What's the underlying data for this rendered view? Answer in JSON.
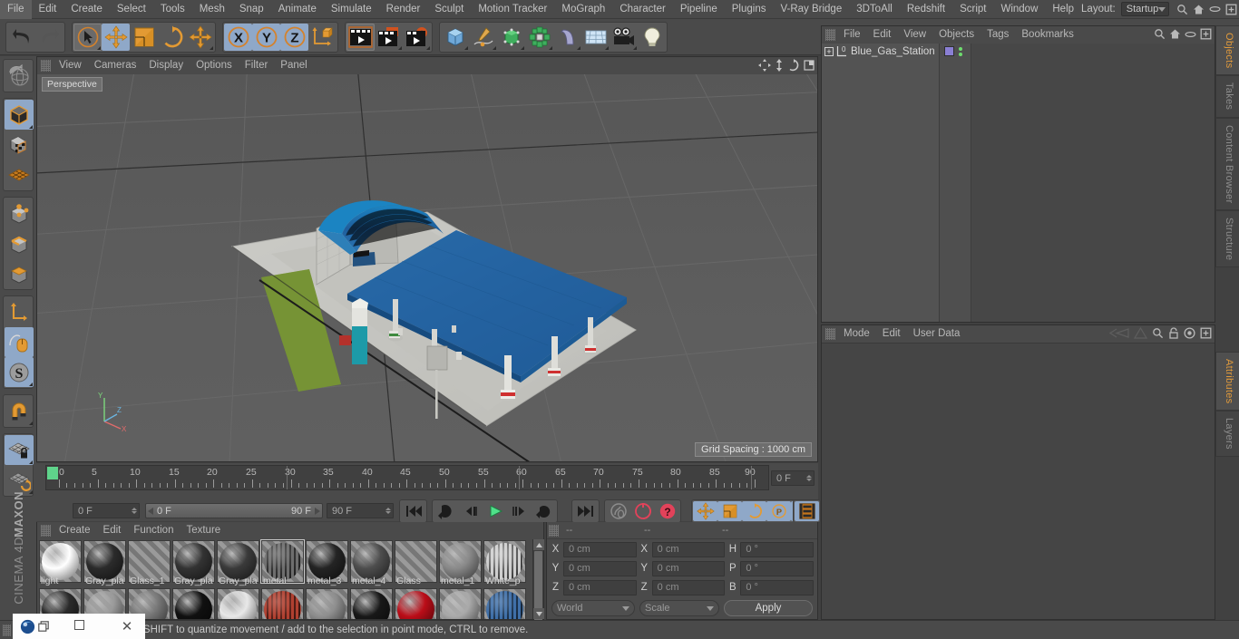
{
  "menubar": {
    "items": [
      "File",
      "Edit",
      "Create",
      "Select",
      "Tools",
      "Mesh",
      "Snap",
      "Animate",
      "Simulate",
      "Render",
      "Sculpt",
      "Motion Tracker",
      "MoGraph",
      "Character",
      "Pipeline",
      "Plugins",
      "V-Ray Bridge",
      "3DToAll",
      "Redshift",
      "Script",
      "Window",
      "Help"
    ],
    "layout_label": "Layout:",
    "layout_value": "Startup",
    "icons": [
      "search-icon",
      "home-icon",
      "pill-icon",
      "new-window-icon"
    ]
  },
  "toolbar": {
    "groups": [
      {
        "name": "undo-redo",
        "buttons": [
          {
            "icon": "undo-icon",
            "label": "Undo",
            "state": "normal"
          },
          {
            "icon": "redo-icon",
            "label": "Redo",
            "state": "disabled"
          }
        ]
      },
      {
        "name": "transform-tools",
        "buttons": [
          {
            "icon": "live-selection-icon",
            "label": "Live Selection",
            "state": "active"
          },
          {
            "icon": "move-icon",
            "label": "Move",
            "state": "selected"
          },
          {
            "icon": "scale-icon",
            "label": "Scale",
            "state": "normal"
          },
          {
            "icon": "rotate-icon",
            "label": "Rotate",
            "state": "normal"
          },
          {
            "icon": "move-alt-icon",
            "label": "Move",
            "state": "normal"
          }
        ]
      },
      {
        "name": "axis-locks",
        "buttons": [
          {
            "icon": "x-axis-icon",
            "label": "X Axis",
            "state": "selected"
          },
          {
            "icon": "y-axis-icon",
            "label": "Y Axis",
            "state": "selected"
          },
          {
            "icon": "z-axis-icon",
            "label": "Z Axis",
            "state": "selected"
          },
          {
            "icon": "world-object-axis-icon",
            "label": "World / Object Coordinate System",
            "state": "normal"
          }
        ]
      },
      {
        "name": "render-tools",
        "buttons": [
          {
            "icon": "render-view-icon",
            "label": "Render View",
            "state": "active"
          },
          {
            "icon": "render-region-icon",
            "label": "Render Region",
            "state": "normal"
          },
          {
            "icon": "render-settings-icon",
            "label": "Edit Render Settings",
            "state": "normal"
          }
        ]
      },
      {
        "name": "create-objects",
        "buttons": [
          {
            "icon": "cube-primitive-icon",
            "label": "Add Cube Object",
            "state": "normal"
          },
          {
            "icon": "spline-pen-icon",
            "label": "Spline Pen",
            "state": "normal"
          },
          {
            "icon": "generator-icon",
            "label": "Subdivision Surface",
            "state": "normal"
          },
          {
            "icon": "mograph-cloner-icon",
            "label": "MoGraph Cloner",
            "state": "normal"
          },
          {
            "icon": "deformer-bend-icon",
            "label": "Bend Deformer",
            "state": "normal"
          },
          {
            "icon": "environment-floor-icon",
            "label": "Floor / Environment",
            "state": "normal"
          },
          {
            "icon": "camera-icon",
            "label": "Camera",
            "state": "normal"
          },
          {
            "icon": "light-icon",
            "label": "Light",
            "state": "normal"
          }
        ]
      }
    ]
  },
  "leftbar": {
    "groups": [
      {
        "buttons": [
          {
            "icon": "undo-view-globe-icon",
            "label": "Undo View",
            "state": "normal"
          }
        ]
      },
      {
        "buttons": [
          {
            "icon": "model-mode-icon",
            "label": "Model Mode",
            "state": "selected"
          },
          {
            "icon": "texture-mode-icon",
            "label": "Texture Mode",
            "state": "normal"
          },
          {
            "icon": "deformer-grid-icon",
            "label": "Deformed Editing",
            "state": "normal"
          }
        ]
      },
      {
        "buttons": [
          {
            "icon": "points-mode-icon",
            "label": "Points Mode",
            "state": "normal"
          },
          {
            "icon": "edges-mode-icon",
            "label": "Edges Mode",
            "state": "normal"
          },
          {
            "icon": "polygons-mode-icon",
            "label": "Polygons Mode",
            "state": "normal"
          }
        ]
      },
      {
        "buttons": [
          {
            "icon": "axis-move-icon",
            "label": "Enable Axis Modification",
            "state": "normal"
          },
          {
            "icon": "viewport-solo-mouse-icon",
            "label": "Viewport Solo Single",
            "state": "selected"
          },
          {
            "icon": "workplane-icon",
            "label": "Workplane",
            "state": "selected"
          }
        ]
      },
      {
        "buttons": [
          {
            "icon": "magnet-icon",
            "label": "Enable Snapping",
            "state": "normal"
          }
        ]
      },
      {
        "buttons": [
          {
            "icon": "lock-workplane-icon",
            "label": "Lock Workplane",
            "state": "selected"
          },
          {
            "icon": "planar-workplane-icon",
            "label": "Planar Workplane",
            "state": "normal"
          }
        ]
      }
    ],
    "brand_line1": "MAXON",
    "brand_line2": "CINEMA 4D"
  },
  "viewport": {
    "menu_items": [
      "View",
      "Cameras",
      "Display",
      "Options",
      "Filter",
      "Panel"
    ],
    "right_icons": [
      "pan-icon",
      "move-camera-icon",
      "rotate-camera-icon",
      "maximize-view-icon"
    ],
    "view_label": "Perspective",
    "grid_spacing": "Grid Spacing : 1000 cm",
    "axis_labels": {
      "x": "X",
      "y": "Y",
      "z": "Z"
    },
    "scene_name": "Blue_Gas_Station"
  },
  "timeline": {
    "ruler_labels": [
      "0",
      "5",
      "10",
      "15",
      "20",
      "25",
      "30",
      "35",
      "40",
      "45",
      "50",
      "55",
      "60",
      "65",
      "70",
      "75",
      "80",
      "85",
      "90"
    ],
    "current_frame_right": "0 F",
    "current_frame_left": "0 F",
    "range_start": "0 F",
    "range_end": "90 F",
    "preview_end": "90 F",
    "transport": [
      {
        "icon": "go-to-start-icon",
        "label": "Go To Start Frame",
        "state": "normal"
      },
      {
        "icon": "play-reverse-icon",
        "label": "Play Backwards",
        "state": "normal"
      },
      {
        "icon": "previous-frame-icon",
        "label": "Go To Previous Frame",
        "state": "normal"
      },
      {
        "icon": "play-forward-icon",
        "label": "Play Forwards",
        "state": "normal"
      },
      {
        "icon": "next-frame-icon",
        "label": "Go To Next Frame",
        "state": "normal"
      },
      {
        "icon": "loop-icon",
        "label": "Loop Preview Range",
        "state": "normal"
      },
      {
        "icon": "go-to-end-icon",
        "label": "Go To End Frame",
        "state": "normal"
      }
    ],
    "keyframe_tools": [
      {
        "icon": "record-key-icon",
        "label": "Record Active Objects",
        "state": "disabled"
      },
      {
        "icon": "autokey-icon",
        "label": "Autokeying",
        "state": "normal"
      },
      {
        "icon": "keyframe-selection-icon",
        "label": "Keyframe Selection",
        "state": "normal"
      }
    ],
    "key_filters": [
      {
        "icon": "position-key-icon",
        "label": "Record Position",
        "state": "selected"
      },
      {
        "icon": "scale-key-icon",
        "label": "Record Scale",
        "state": "selected"
      },
      {
        "icon": "rotation-key-icon",
        "label": "Record Rotation",
        "state": "selected"
      },
      {
        "icon": "parameter-key-icon",
        "label": "Record Parameter",
        "state": "selected"
      },
      {
        "icon": "point-level-key-icon",
        "label": "Record Point Level Animation",
        "state": "selected"
      }
    ],
    "timeline_toggle": {
      "icon": "timeline-strip-icon",
      "label": "Show Timeline",
      "state": "selected"
    }
  },
  "material_manager": {
    "menu_items": [
      "Create",
      "Edit",
      "Function",
      "Texture"
    ],
    "materials": [
      {
        "name": "light",
        "color": "#ffffff",
        "kind": "plain",
        "selected": false
      },
      {
        "name": "Gray_pla",
        "color": "#2b2b2b",
        "kind": "plain",
        "selected": false
      },
      {
        "name": "Glass_1",
        "color": "",
        "kind": "empty",
        "selected": false
      },
      {
        "name": "Gray_pla",
        "color": "#333333",
        "kind": "plain",
        "selected": false
      },
      {
        "name": "Gray_pla",
        "color": "#3a3a3a",
        "kind": "plain",
        "selected": false
      },
      {
        "name": "metal",
        "color": "#6e6e6e",
        "kind": "textured",
        "selected": true
      },
      {
        "name": "metal_3",
        "color": "#242424",
        "kind": "plain",
        "selected": false
      },
      {
        "name": "metal_4",
        "color": "#4d4d4d",
        "kind": "plain",
        "selected": false
      },
      {
        "name": "Glass",
        "color": "",
        "kind": "empty",
        "selected": false
      },
      {
        "name": "metal_1",
        "color": "#8a8a8a",
        "kind": "plain",
        "selected": false
      },
      {
        "name": "White_p",
        "color": "#cfcfcf",
        "kind": "textured",
        "selected": false
      },
      {
        "name": "",
        "color": "#2a2a2a",
        "kind": "plain",
        "selected": false
      },
      {
        "name": "",
        "color": "#9a9a9a",
        "kind": "plain",
        "selected": false
      },
      {
        "name": "",
        "color": "#777777",
        "kind": "plain",
        "selected": false
      },
      {
        "name": "",
        "color": "#101010",
        "kind": "plain",
        "selected": false
      },
      {
        "name": "",
        "color": "#e8e8e8",
        "kind": "plain",
        "selected": false
      },
      {
        "name": "",
        "color": "#b04030",
        "kind": "textured",
        "selected": false
      },
      {
        "name": "",
        "color": "#8e8e8e",
        "kind": "plain",
        "selected": false
      },
      {
        "name": "",
        "color": "#181818",
        "kind": "plain",
        "selected": false
      },
      {
        "name": "",
        "color": "#bb0d18",
        "kind": "plain",
        "selected": false
      },
      {
        "name": "",
        "color": "#a9a9a9",
        "kind": "plain",
        "selected": false
      },
      {
        "name": "",
        "color": "#3f6fa8",
        "kind": "textured",
        "selected": false
      }
    ],
    "scroll_up_icon": "scroll-up-icon",
    "scroll_down_icon": "scroll-down-icon"
  },
  "coordinates": {
    "header_cols": [
      "--",
      "--",
      "--"
    ],
    "rows": [
      {
        "pos_label": "X",
        "pos_value": "0 cm",
        "size_label": "X",
        "size_value": "0 cm",
        "rot_label": "H",
        "rot_value": "0 °"
      },
      {
        "pos_label": "Y",
        "pos_value": "0 cm",
        "size_label": "Y",
        "size_value": "0 cm",
        "rot_label": "P",
        "rot_value": "0 °"
      },
      {
        "pos_label": "Z",
        "pos_value": "0 cm",
        "size_label": "Z",
        "size_value": "0 cm",
        "rot_label": "B",
        "rot_value": "0 °"
      }
    ],
    "coord_system": "World",
    "size_mode": "Scale",
    "apply_label": "Apply"
  },
  "object_manager": {
    "menu_items": [
      "File",
      "Edit",
      "View",
      "Objects",
      "Tags",
      "Bookmarks"
    ],
    "right_icons": [
      "search-icon",
      "home-icon",
      "pill-icon",
      "new-window-icon"
    ],
    "objects": [
      {
        "name": "Blue_Gas_Station",
        "expanded": false,
        "layer_color": "#8a7fd4",
        "visible_dots": 2
      }
    ]
  },
  "attributes_manager": {
    "menu_items": [
      "Mode",
      "Edit",
      "User Data"
    ],
    "right_icons": [
      "prev-attr-icon",
      "next-attr-icon",
      "search-icon",
      "lock-icon",
      "target-icon",
      "new-window-icon"
    ]
  },
  "right_tabs_top": [
    {
      "label": "Objects",
      "active": true
    },
    {
      "label": "Takes",
      "active": false
    },
    {
      "label": "Content Browser",
      "active": false
    },
    {
      "label": "Structure",
      "active": false
    }
  ],
  "right_tabs_bottom": [
    {
      "label": "Attributes",
      "active": true
    },
    {
      "label": "Layers",
      "active": false
    }
  ],
  "statusbar": {
    "text": "move elements. Hold down SHIFT to quantize movement / add to the selection in point mode, CTRL to remove."
  },
  "os_taskbar": {
    "app_icon": "cinema4d-app-icon",
    "restore_icon": "restore-window-icon",
    "minimize_icon": "minimize-window-icon",
    "maximize_icon": "maximize-window-icon",
    "close_icon": "close-window-icon"
  },
  "colors": {
    "panel_bg": "#4a4a4a",
    "viewport_bg": "#5b5b5b",
    "accent_orange": "#e09a3c",
    "selected_blue": "#8fa8c8",
    "roof_blue": "#1f5c9e",
    "canopy_blue": "#2a6aa8",
    "grass_green": "#6f8c2f",
    "concrete": "#c9c9c4"
  }
}
